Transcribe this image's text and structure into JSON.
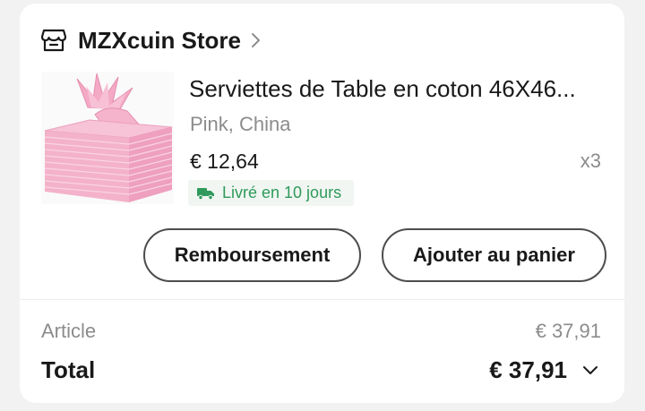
{
  "store": {
    "name": "MZXcuin Store",
    "icon": "store-icon",
    "chevron_icon": "chevron-right-icon"
  },
  "product": {
    "title": "Serviettes de Table en coton 46X46...",
    "variant": "Pink, China",
    "price": "€ 12,64",
    "quantity": "x3",
    "image": "pink-napkins-image",
    "delivery": {
      "text": "Livré en 10 jours",
      "icon": "truck-icon",
      "color": "#2f9a5b"
    }
  },
  "actions": {
    "refund_label": "Remboursement",
    "add_to_cart_label": "Ajouter au panier"
  },
  "summary": {
    "article_label": "Article",
    "article_value": "€ 37,91",
    "total_label": "Total",
    "total_value": "€ 37,91",
    "expand_icon": "chevron-down-icon"
  }
}
